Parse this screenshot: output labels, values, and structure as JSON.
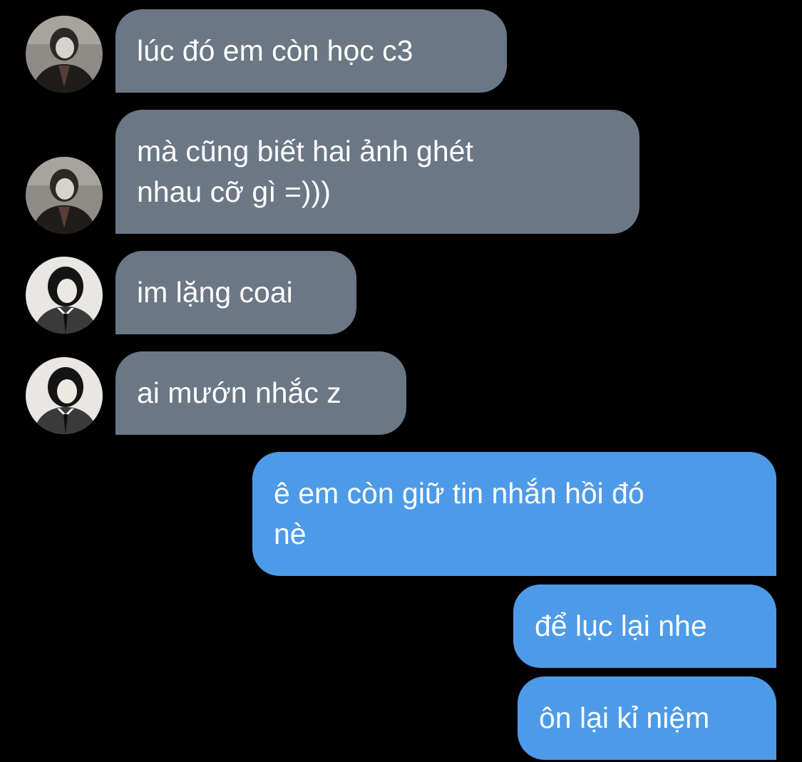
{
  "conversation": {
    "messages": [
      {
        "sender": "contact-a",
        "text": "lúc đó em còn học c3"
      },
      {
        "sender": "contact-a",
        "text": "mà cũng biết hai ảnh ghét\nnhau cỡ gì =)))"
      },
      {
        "sender": "contact-b",
        "text": "im lặng coai"
      },
      {
        "sender": "contact-b",
        "text": "ai mướn nhắc z"
      },
      {
        "sender": "me",
        "text": "ê em còn giữ tin nhắn hồi đó\nnè"
      },
      {
        "sender": "me",
        "text": "để lục lại nhe"
      },
      {
        "sender": "me",
        "text": "ôn lại kỉ niệm"
      }
    ]
  },
  "colors": {
    "background": "#000000",
    "incoming_bubble": "#6b7785",
    "outgoing_bubble": "#4d9be8",
    "text": "#ffffff"
  },
  "icons": {
    "avatar_a": "avatar-dark-jacket",
    "avatar_b": "avatar-suit-tie"
  }
}
